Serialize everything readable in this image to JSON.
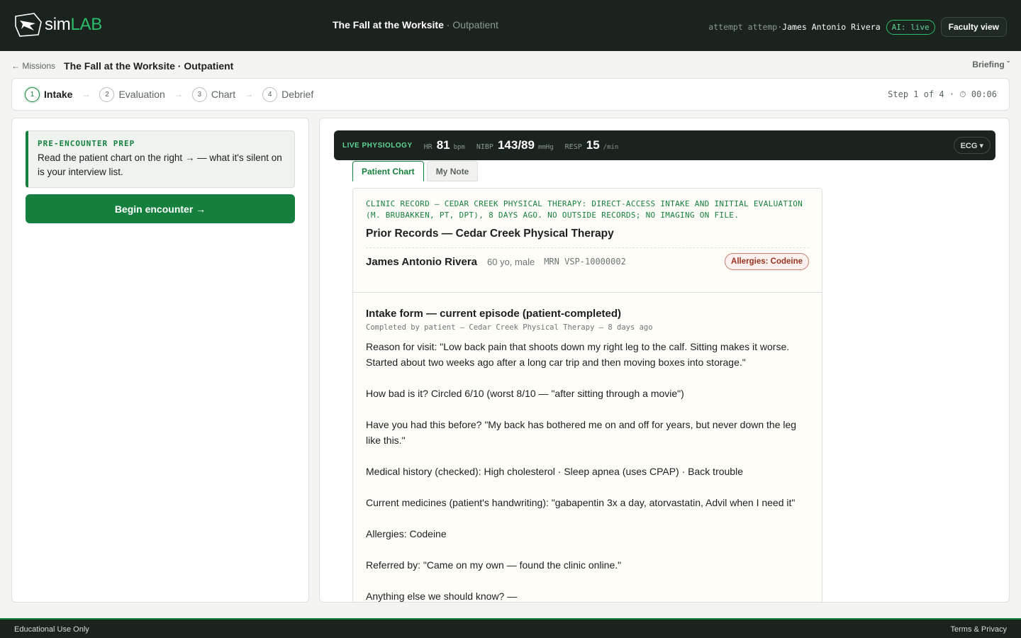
{
  "app": {
    "logo_text_sim": "sim",
    "logo_text_lab": "LAB",
    "case_title": "The Fall at the Worksite",
    "case_setting": "· Outpatient",
    "attempt_text": "attempt attemp·",
    "user_name": "James Antonio Rivera",
    "ai_status": "AI: live",
    "faculty_button": "Faculty view"
  },
  "breadcrumb": {
    "back": "← Missions",
    "title": "The Fall at the Worksite · Outpatient",
    "briefing": "Briefing ˇ"
  },
  "stepper": {
    "steps": [
      {
        "num": "1",
        "label": "Intake"
      },
      {
        "num": "2",
        "label": "Evaluation"
      },
      {
        "num": "3",
        "label": "Chart"
      },
      {
        "num": "4",
        "label": "Debrief"
      }
    ],
    "arrow": "→",
    "status": "Step 1 of 4 · ⏱ 00:06"
  },
  "left": {
    "prep_label": "PRE-ENCOUNTER PREP",
    "prep_text": "Read the patient chart on the right → — what it's silent on is your interview list.",
    "begin_button": "Begin encounter →"
  },
  "physiology": {
    "label": "LIVE PHYSIOLOGY",
    "vitals": [
      {
        "name": "HR",
        "value": "81",
        "unit": "bpm"
      },
      {
        "name": "NIBP",
        "value": "143/89",
        "unit": "mmHg"
      },
      {
        "name": "RESP",
        "value": "15",
        "unit": "/min"
      }
    ],
    "ecg_button": "ECG ▾"
  },
  "tabs": [
    {
      "label": "Patient Chart",
      "active": true
    },
    {
      "label": "My Note",
      "active": false
    }
  ],
  "chart": {
    "record_header": "CLINIC RECORD — CEDAR CREEK PHYSICAL THERAPY: DIRECT-ACCESS INTAKE AND INITIAL EVALUATION (M. BRUBAKKEN, PT, DPT), 8 DAYS AGO. NO OUTSIDE RECORDS; NO IMAGING ON FILE.",
    "title": "Prior Records — Cedar Creek Physical Therapy",
    "patient_name": "James Antonio Rivera",
    "patient_age_sex": "60 yo, male",
    "mrn": "MRN VSP-10000002",
    "allergy_badge": "Allergies: Codeine",
    "section_title": "Intake form — current episode (patient-completed)",
    "section_meta": "Completed by patient — Cedar Creek Physical Therapy — 8 days ago",
    "paragraphs": [
      "Reason for visit: \"Low back pain that shoots down my right leg to the calf. Sitting makes it worse. Started about two weeks ago after a long car trip and then moving boxes into storage.\"",
      "How bad is it? Circled 6/10 (worst 8/10 — \"after sitting through a movie\")",
      "Have you had this before? \"My back has bothered me on and off for years, but never down the leg like this.\"",
      "Medical history (checked): High cholesterol · Sleep apnea (uses CPAP) · Back trouble",
      "Current medicines (patient's handwriting): \"gabapentin 3x a day, atorvastatin, Advil when I need it\"",
      "Allergies: Codeine",
      "Referred by: \"Came on my own — found the clinic online.\"",
      "Anything else we should know? —"
    ]
  },
  "footer": {
    "left": "Educational Use Only",
    "right": "Terms & Privacy"
  },
  "colors": {
    "brand_green": "#15803d",
    "dark_bg": "#1a231d",
    "allergy_red": "#9c3320"
  }
}
